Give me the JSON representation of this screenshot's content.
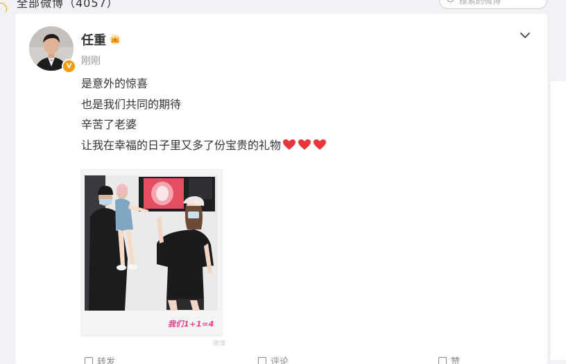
{
  "header": {
    "feed_title": "全部微博（4057）",
    "search_placeholder": "搜索的微博"
  },
  "post": {
    "author": "任重",
    "verified_badge": "V",
    "time": "刚刚",
    "lines": [
      "是意外的惊喜",
      "也是我们共同的期待",
      "辛苦了老婆",
      "让我在幸福的日子里又多了份宝贵的礼物"
    ],
    "photo_caption": "我们1+1=4",
    "watermark": "微博"
  },
  "actions": {
    "share": "转发",
    "comment": "评论",
    "like": "赞"
  },
  "colors": {
    "accent_orange": "#f59a00",
    "heart_red": "#e8363b",
    "caption_pink": "#e83d8a"
  }
}
